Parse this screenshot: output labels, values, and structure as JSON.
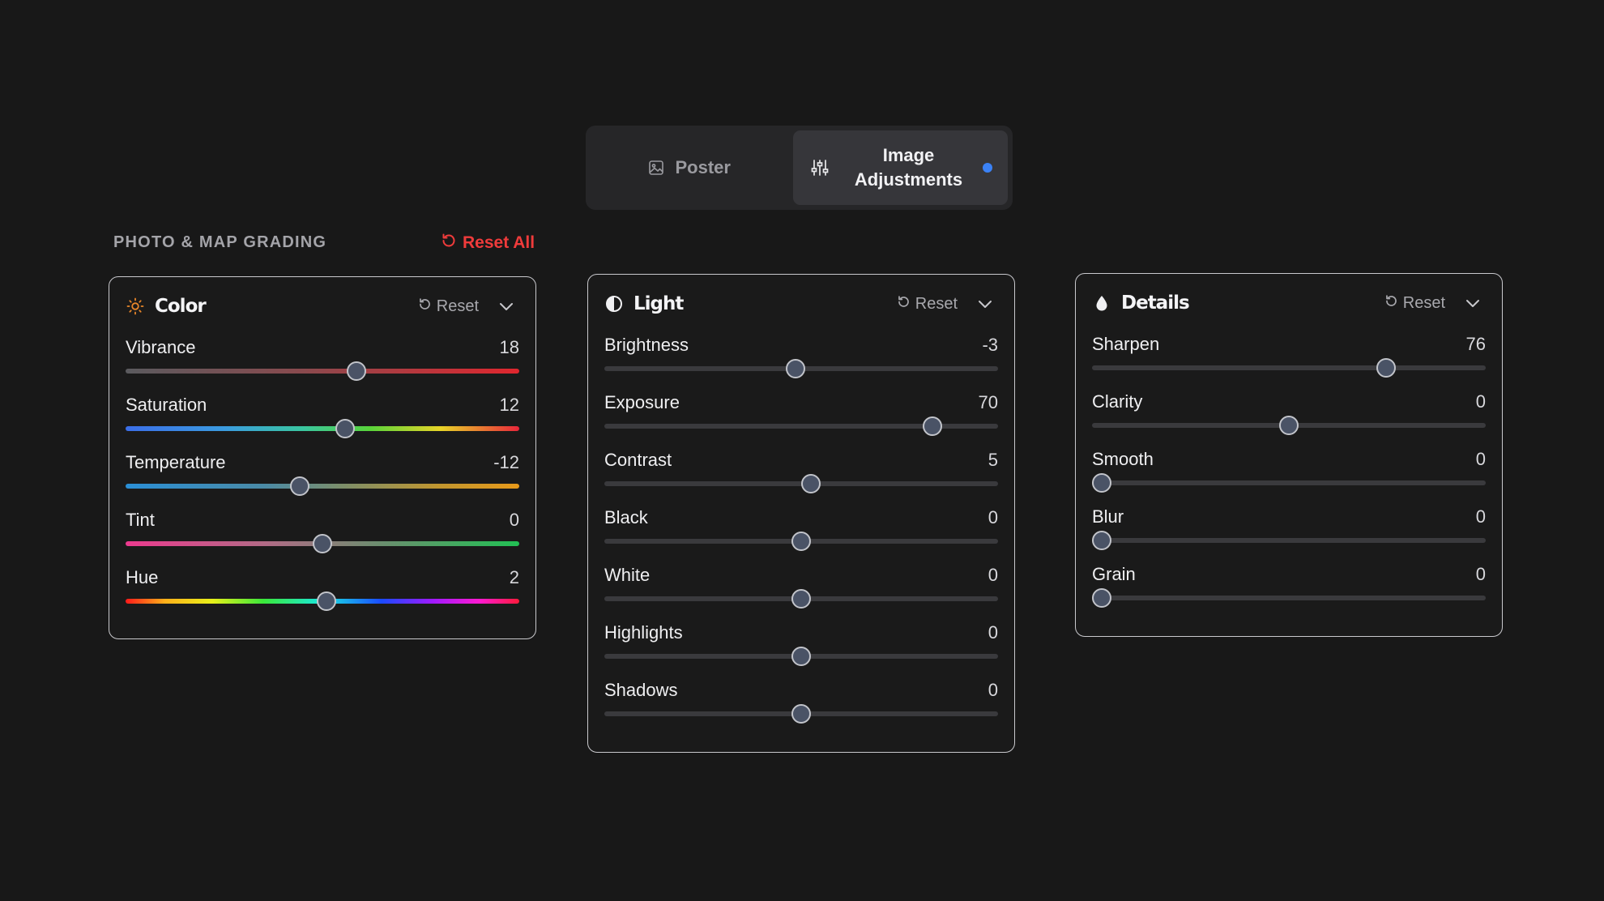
{
  "tabs": [
    {
      "label": "Poster",
      "icon": "image-icon",
      "active": false
    },
    {
      "label": "Image Adjustments",
      "icon": "sliders-icon",
      "active": true
    }
  ],
  "section": {
    "title": "PHOTO & MAP GRADING",
    "reset_all_label": "Reset All"
  },
  "colors": {
    "accent_blue": "#3b82f6",
    "danger_red": "#ef3b3b",
    "color_icon": "#e8862a"
  },
  "panels": {
    "color": {
      "title": "Color",
      "icon": "sun-icon",
      "reset_label": "Reset",
      "sliders": [
        {
          "label": "Vibrance",
          "value": "18",
          "position": 0.59
        },
        {
          "label": "Saturation",
          "value": "12",
          "position": 0.56
        },
        {
          "label": "Temperature",
          "value": "-12",
          "position": 0.44
        },
        {
          "label": "Tint",
          "value": "0",
          "position": 0.5
        },
        {
          "label": "Hue",
          "value": "2",
          "position": 0.51
        }
      ]
    },
    "light": {
      "title": "Light",
      "icon": "contrast-icon",
      "reset_label": "Reset",
      "sliders": [
        {
          "label": "Brightness",
          "value": "-3",
          "position": 0.485
        },
        {
          "label": "Exposure",
          "value": "70",
          "position": 0.85
        },
        {
          "label": "Contrast",
          "value": "5",
          "position": 0.525
        },
        {
          "label": "Black",
          "value": "0",
          "position": 0.5
        },
        {
          "label": "White",
          "value": "0",
          "position": 0.5
        },
        {
          "label": "Highlights",
          "value": "0",
          "position": 0.5
        },
        {
          "label": "Shadows",
          "value": "0",
          "position": 0.5
        }
      ]
    },
    "details": {
      "title": "Details",
      "icon": "droplet-icon",
      "reset_label": "Reset",
      "sliders": [
        {
          "label": "Sharpen",
          "value": "76",
          "position": 0.76
        },
        {
          "label": "Clarity",
          "value": "0",
          "position": 0.5
        },
        {
          "label": "Smooth",
          "value": "0",
          "position": 0.0
        },
        {
          "label": "Blur",
          "value": "0",
          "position": 0.0
        },
        {
          "label": "Grain",
          "value": "0",
          "position": 0.0
        }
      ]
    }
  }
}
